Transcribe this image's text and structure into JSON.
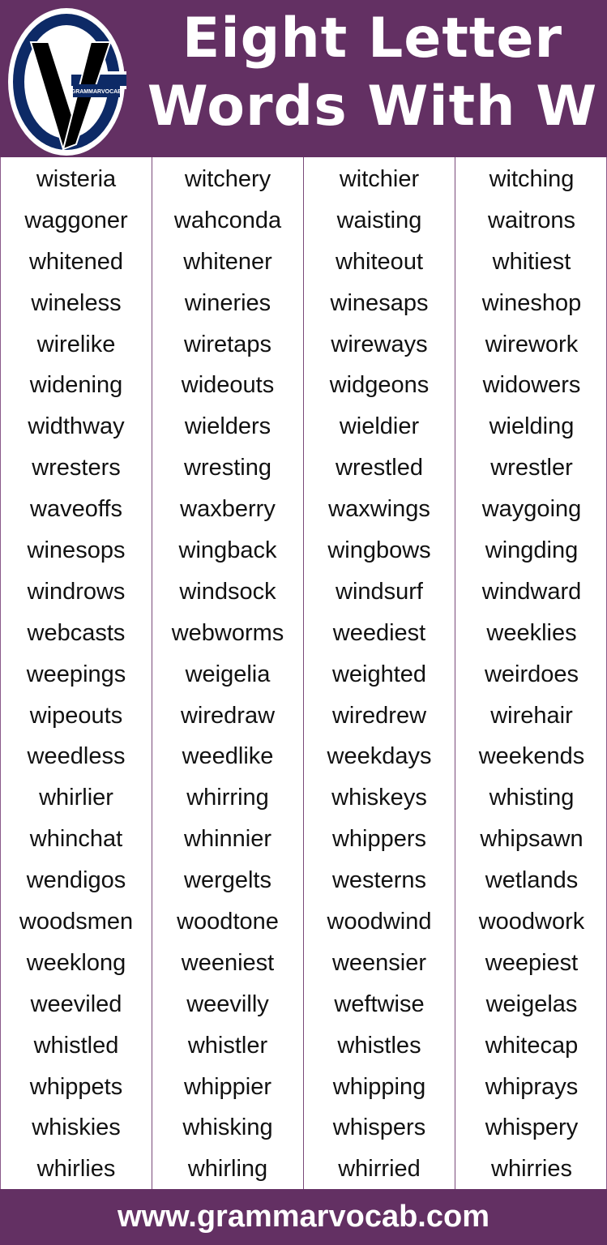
{
  "header": {
    "title_line1": "Eight Letter",
    "title_line2": "Words With W",
    "logo_text": "GRAMMARVOCAB"
  },
  "colors": {
    "brand_purple": "#633063",
    "logo_navy": "#0d2a66",
    "text": "#111111"
  },
  "columns": [
    [
      "wisteria",
      "waggoner",
      "whitened",
      "wineless",
      "wirelike",
      "widening",
      "widthway",
      "wresters",
      "waveoffs",
      "winesops",
      "windrows",
      "webcasts",
      "weepings",
      "wipeouts",
      "weedless",
      "whirlier",
      "whinchat",
      "wendigos",
      "woodsmen",
      "weeklong",
      "weeviled",
      "whistled",
      "whippets",
      "whiskies",
      "whirlies"
    ],
    [
      "witchery",
      "wahconda",
      "whitener",
      "wineries",
      "wiretaps",
      "wideouts",
      "wielders",
      "wresting",
      "waxberry",
      "wingback",
      "windsock",
      "webworms",
      "weigelia",
      "wiredraw",
      "weedlike",
      "whirring",
      "whinnier",
      "wergelts",
      "woodtone",
      "weeniest",
      "weevilly",
      "whistler",
      "whippier",
      "whisking",
      "whirling"
    ],
    [
      "witchier",
      "waisting",
      "whiteout",
      "winesaps",
      "wireways",
      "widgeons",
      "wieldier",
      "wrestled",
      "waxwings",
      "wingbows",
      "windsurf",
      "weediest",
      "weighted",
      "wiredrew",
      "weekdays",
      "whiskeys",
      "whippers",
      "westerns",
      "woodwind",
      "weensier",
      "weftwise",
      "whistles",
      "whipping",
      "whispers",
      "whirried"
    ],
    [
      "witching",
      "waitrons",
      "whitiest",
      "wineshop",
      "wirework",
      "widowers",
      "wielding",
      "wrestler",
      "waygoing",
      "wingding",
      "windward",
      "weeklies",
      "weirdoes",
      "wirehair",
      "weekends",
      "whisting",
      "whipsawn",
      "wetlands",
      "woodwork",
      "weepiest",
      "weigelas",
      "whitecap",
      "whiprays",
      "whispery",
      "whirries"
    ]
  ],
  "footer": {
    "url": "www.grammarvocab.com"
  }
}
